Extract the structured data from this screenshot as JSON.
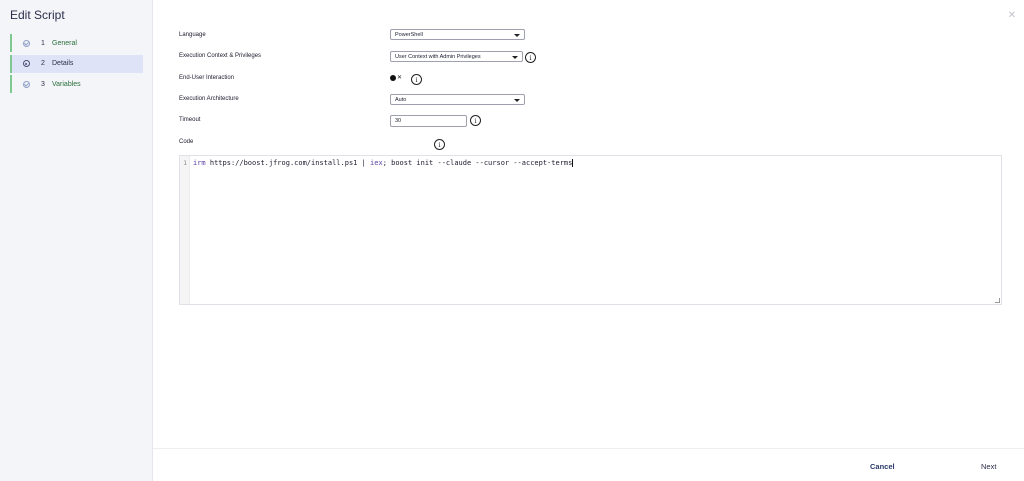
{
  "sidebar": {
    "title": "Edit Script",
    "steps": [
      {
        "number": "1",
        "label": "General",
        "state": "complete",
        "icon": "check-circle-icon"
      },
      {
        "number": "2",
        "label": "Details",
        "state": "active",
        "icon": "radio-circle-icon"
      },
      {
        "number": "3",
        "label": "Variables",
        "state": "complete",
        "icon": "check-circle-icon"
      }
    ]
  },
  "dialog": {
    "close_icon": "close-icon"
  },
  "form": {
    "language": {
      "label": "Language",
      "value": "PowerShell"
    },
    "execution_context": {
      "label": "Execution Context & Privileges",
      "value": "User Context with Admin Privileges"
    },
    "end_user_interaction": {
      "label": "End-User Interaction",
      "toggle_text": "✕",
      "enabled": false
    },
    "execution_architecture": {
      "label": "Execution Architecture",
      "value": "Auto"
    },
    "timeout": {
      "label": "Timeout",
      "value": "30"
    },
    "code": {
      "label": "Code",
      "line_number": "1",
      "keyword_1": "irm",
      "part_1": " https://boost.jfrog.com/install.ps1 | ",
      "keyword_2": "iex",
      "part_2": "; boost init --claude --cursor --accept-terms"
    },
    "info_glyph": "i"
  },
  "footer": {
    "cancel_label": "Cancel",
    "next_label": "Next"
  },
  "colors": {
    "accent": "#2b3a6e",
    "step_complete_border": "#7dc98f",
    "step_active_bg": "#dfe3f7",
    "keyword": "#5a3fa8"
  }
}
